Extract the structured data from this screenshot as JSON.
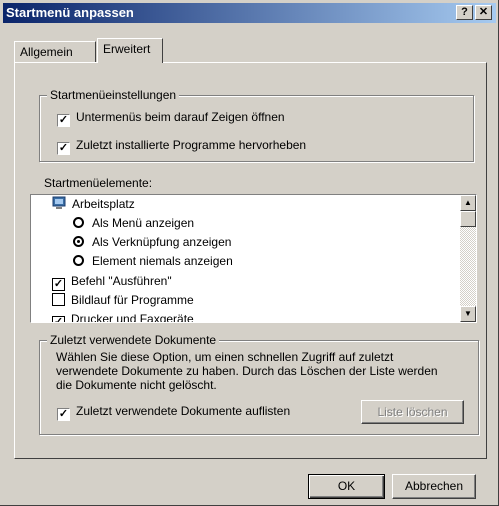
{
  "window": {
    "title": "Startmenü anpassen",
    "help_glyph": "?",
    "close_glyph": "✕"
  },
  "tabs": [
    {
      "label": "Allgemein"
    },
    {
      "label": "Erweitert"
    }
  ],
  "settings_group": {
    "title": "Startmenüeinstellungen",
    "options": [
      {
        "label": "Untermenüs beim darauf Zeigen öffnen",
        "checked": true
      },
      {
        "label": "Zuletzt installierte Programme hervorheben",
        "checked": true
      }
    ]
  },
  "elements": {
    "label": "Startmenüelemente:",
    "items": [
      {
        "type": "icon",
        "icon": "monitor-icon",
        "label": "Arbeitsplatz"
      },
      {
        "type": "radio",
        "label": "Als Menü anzeigen",
        "selected": false
      },
      {
        "type": "radio",
        "label": "Als Verknüpfung anzeigen",
        "selected": true
      },
      {
        "type": "radio",
        "label": "Element niemals anzeigen",
        "selected": false
      },
      {
        "type": "checkbox",
        "label": "Befehl \"Ausführen\"",
        "checked": true
      },
      {
        "type": "checkbox",
        "label": "Bildlauf für Programme",
        "checked": false
      },
      {
        "type": "checkbox",
        "label": "Drucker und Faxgeräte",
        "checked": true
      }
    ]
  },
  "recent_group": {
    "title": "Zuletzt verwendete Dokumente",
    "description": "Wählen Sie diese Option, um einen schnellen Zugriff auf zuletzt verwendete Dokumente zu haben. Durch das Löschen der Liste werden die Dokumente nicht gelöscht.",
    "checkbox_label": "Zuletzt verwendete Dokumente auflisten",
    "checkbox_checked": true,
    "clear_button": "Liste löschen"
  },
  "buttons": {
    "ok": "OK",
    "cancel": "Abbrechen"
  },
  "colors": {
    "titlebar_start": "#0a246a",
    "titlebar_end": "#a6caf0",
    "face": "#d4d0c8"
  }
}
